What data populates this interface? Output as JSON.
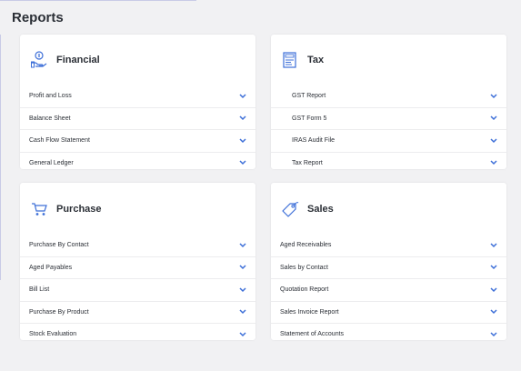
{
  "page": {
    "title": "Reports"
  },
  "colors": {
    "accent": "#3d6fd8",
    "background": "#f1f1f3",
    "card": "#ffffff"
  },
  "cards": {
    "financial": {
      "title": "Financial",
      "icon": "hand-money-icon",
      "items": [
        "Profit and Loss",
        "Balance Sheet",
        "Cash Flow Statement",
        "General Ledger"
      ]
    },
    "tax": {
      "title": "Tax",
      "icon": "tax-document-icon",
      "items": [
        "GST Report",
        "GST Form 5",
        "IRAS Audit File",
        "Tax Report"
      ]
    },
    "purchase": {
      "title": "Purchase",
      "icon": "shopping-cart-icon",
      "items": [
        "Purchase By Contact",
        "Aged Payables",
        "Bill List",
        "Purchase By Product",
        "Stock Evaluation"
      ]
    },
    "sales": {
      "title": "Sales",
      "icon": "price-tag-icon",
      "items": [
        "Aged Receivables",
        "Sales by Contact",
        "Quotation Report",
        "Sales Invoice Report",
        "Statement of Accounts"
      ]
    }
  }
}
